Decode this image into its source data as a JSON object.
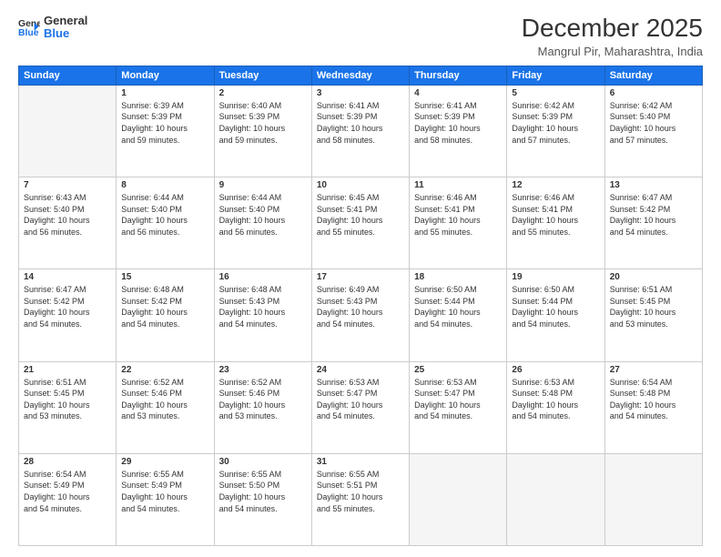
{
  "logo": {
    "line1": "General",
    "line2": "Blue"
  },
  "title": "December 2025",
  "subtitle": "Mangrul Pir, Maharashtra, India",
  "days_header": [
    "Sunday",
    "Monday",
    "Tuesday",
    "Wednesday",
    "Thursday",
    "Friday",
    "Saturday"
  ],
  "weeks": [
    [
      {
        "num": "",
        "info": ""
      },
      {
        "num": "1",
        "info": "Sunrise: 6:39 AM\nSunset: 5:39 PM\nDaylight: 10 hours\nand 59 minutes."
      },
      {
        "num": "2",
        "info": "Sunrise: 6:40 AM\nSunset: 5:39 PM\nDaylight: 10 hours\nand 59 minutes."
      },
      {
        "num": "3",
        "info": "Sunrise: 6:41 AM\nSunset: 5:39 PM\nDaylight: 10 hours\nand 58 minutes."
      },
      {
        "num": "4",
        "info": "Sunrise: 6:41 AM\nSunset: 5:39 PM\nDaylight: 10 hours\nand 58 minutes."
      },
      {
        "num": "5",
        "info": "Sunrise: 6:42 AM\nSunset: 5:39 PM\nDaylight: 10 hours\nand 57 minutes."
      },
      {
        "num": "6",
        "info": "Sunrise: 6:42 AM\nSunset: 5:40 PM\nDaylight: 10 hours\nand 57 minutes."
      }
    ],
    [
      {
        "num": "7",
        "info": "Sunrise: 6:43 AM\nSunset: 5:40 PM\nDaylight: 10 hours\nand 56 minutes."
      },
      {
        "num": "8",
        "info": "Sunrise: 6:44 AM\nSunset: 5:40 PM\nDaylight: 10 hours\nand 56 minutes."
      },
      {
        "num": "9",
        "info": "Sunrise: 6:44 AM\nSunset: 5:40 PM\nDaylight: 10 hours\nand 56 minutes."
      },
      {
        "num": "10",
        "info": "Sunrise: 6:45 AM\nSunset: 5:41 PM\nDaylight: 10 hours\nand 55 minutes."
      },
      {
        "num": "11",
        "info": "Sunrise: 6:46 AM\nSunset: 5:41 PM\nDaylight: 10 hours\nand 55 minutes."
      },
      {
        "num": "12",
        "info": "Sunrise: 6:46 AM\nSunset: 5:41 PM\nDaylight: 10 hours\nand 55 minutes."
      },
      {
        "num": "13",
        "info": "Sunrise: 6:47 AM\nSunset: 5:42 PM\nDaylight: 10 hours\nand 54 minutes."
      }
    ],
    [
      {
        "num": "14",
        "info": "Sunrise: 6:47 AM\nSunset: 5:42 PM\nDaylight: 10 hours\nand 54 minutes."
      },
      {
        "num": "15",
        "info": "Sunrise: 6:48 AM\nSunset: 5:42 PM\nDaylight: 10 hours\nand 54 minutes."
      },
      {
        "num": "16",
        "info": "Sunrise: 6:48 AM\nSunset: 5:43 PM\nDaylight: 10 hours\nand 54 minutes."
      },
      {
        "num": "17",
        "info": "Sunrise: 6:49 AM\nSunset: 5:43 PM\nDaylight: 10 hours\nand 54 minutes."
      },
      {
        "num": "18",
        "info": "Sunrise: 6:50 AM\nSunset: 5:44 PM\nDaylight: 10 hours\nand 54 minutes."
      },
      {
        "num": "19",
        "info": "Sunrise: 6:50 AM\nSunset: 5:44 PM\nDaylight: 10 hours\nand 54 minutes."
      },
      {
        "num": "20",
        "info": "Sunrise: 6:51 AM\nSunset: 5:45 PM\nDaylight: 10 hours\nand 53 minutes."
      }
    ],
    [
      {
        "num": "21",
        "info": "Sunrise: 6:51 AM\nSunset: 5:45 PM\nDaylight: 10 hours\nand 53 minutes."
      },
      {
        "num": "22",
        "info": "Sunrise: 6:52 AM\nSunset: 5:46 PM\nDaylight: 10 hours\nand 53 minutes."
      },
      {
        "num": "23",
        "info": "Sunrise: 6:52 AM\nSunset: 5:46 PM\nDaylight: 10 hours\nand 53 minutes."
      },
      {
        "num": "24",
        "info": "Sunrise: 6:53 AM\nSunset: 5:47 PM\nDaylight: 10 hours\nand 54 minutes."
      },
      {
        "num": "25",
        "info": "Sunrise: 6:53 AM\nSunset: 5:47 PM\nDaylight: 10 hours\nand 54 minutes."
      },
      {
        "num": "26",
        "info": "Sunrise: 6:53 AM\nSunset: 5:48 PM\nDaylight: 10 hours\nand 54 minutes."
      },
      {
        "num": "27",
        "info": "Sunrise: 6:54 AM\nSunset: 5:48 PM\nDaylight: 10 hours\nand 54 minutes."
      }
    ],
    [
      {
        "num": "28",
        "info": "Sunrise: 6:54 AM\nSunset: 5:49 PM\nDaylight: 10 hours\nand 54 minutes."
      },
      {
        "num": "29",
        "info": "Sunrise: 6:55 AM\nSunset: 5:49 PM\nDaylight: 10 hours\nand 54 minutes."
      },
      {
        "num": "30",
        "info": "Sunrise: 6:55 AM\nSunset: 5:50 PM\nDaylight: 10 hours\nand 54 minutes."
      },
      {
        "num": "31",
        "info": "Sunrise: 6:55 AM\nSunset: 5:51 PM\nDaylight: 10 hours\nand 55 minutes."
      },
      {
        "num": "",
        "info": ""
      },
      {
        "num": "",
        "info": ""
      },
      {
        "num": "",
        "info": ""
      }
    ]
  ]
}
